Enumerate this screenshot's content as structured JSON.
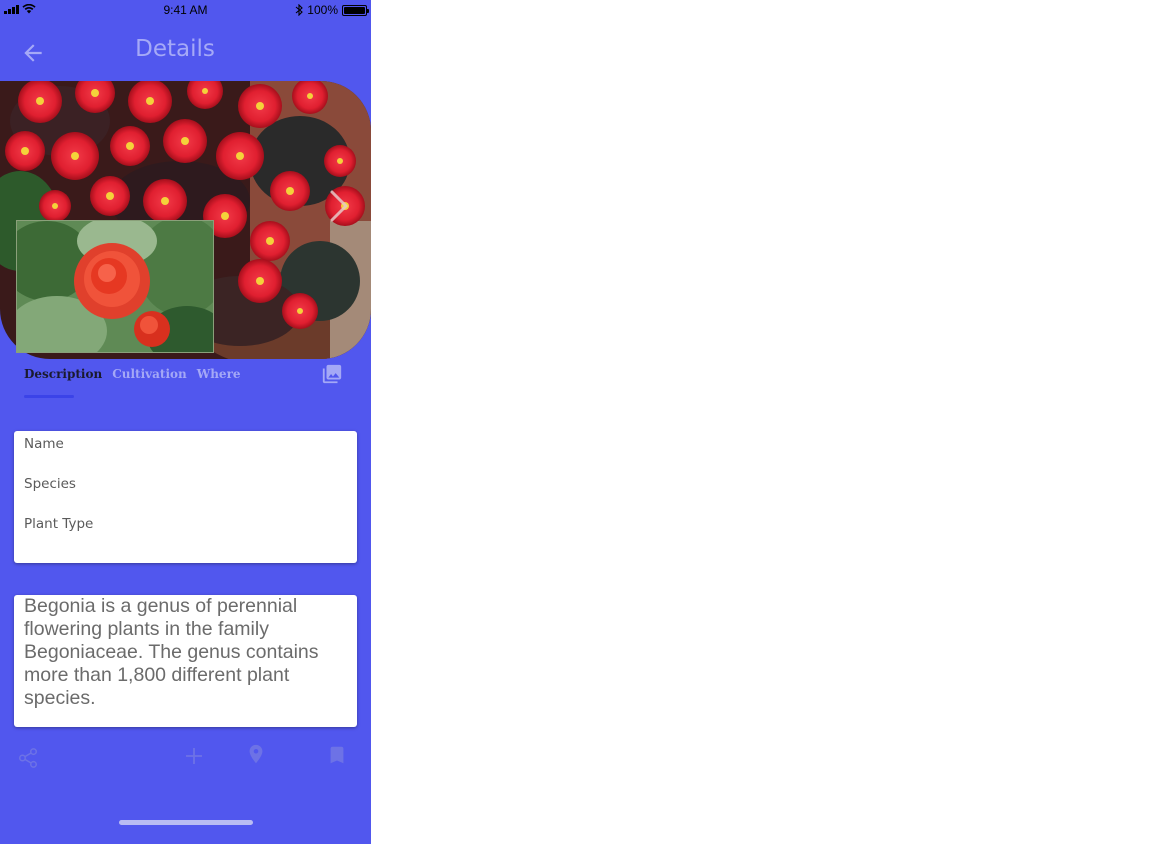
{
  "status_bar": {
    "time": "9:41 AM",
    "battery": "100%"
  },
  "header": {
    "title": "Details",
    "back_icon": "arrow-left-icon"
  },
  "carousel": {
    "next_icon": "chevron-right-icon"
  },
  "tabs": [
    {
      "label": "Description",
      "active": true
    },
    {
      "label": "Cultivation",
      "active": false
    },
    {
      "label": "Where",
      "active": false
    }
  ],
  "gallery_icon": "photo-library-icon",
  "info_card": {
    "name_label": "Name",
    "species_label": "Species",
    "plant_type_label": "Plant Type"
  },
  "description": {
    "text": "Begonia is a genus of perennial flowering plants in the family Begoniaceae. The genus contains more than 1,800 different plant species."
  },
  "actions": {
    "share_icon": "share-icon",
    "add_icon": "plus-icon",
    "location_icon": "location-pin-icon",
    "bookmark_icon": "bookmark-icon"
  },
  "colors": {
    "background": "#5157ee",
    "title": "#a5a9f7",
    "tab_active": "#1a1a2e",
    "tab_inactive": "#a4a8f6",
    "tab_indicator": "#3b43e8",
    "action_icon": "#6d72e6"
  }
}
